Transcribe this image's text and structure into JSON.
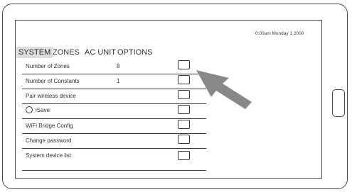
{
  "status_bar": {
    "datetime": "0:00am Monday 1  2000"
  },
  "tabs": [
    {
      "label": "SYSTEM",
      "active": true
    },
    {
      "label": "ZONES",
      "active": false
    },
    {
      "label": "AC UNIT",
      "active": false
    },
    {
      "label": "OPTIONS",
      "active": false
    }
  ],
  "rows": [
    {
      "label": "Number of Zones",
      "value": "8"
    },
    {
      "label": "Number of Constants",
      "value": "1"
    },
    {
      "label": "Pair wireless device",
      "value": ""
    },
    {
      "label": "iSave",
      "value": ""
    },
    {
      "label": "WiFi Bridge Config",
      "value": ""
    },
    {
      "label": "Change password",
      "value": ""
    },
    {
      "label": "System device list",
      "value": ""
    }
  ],
  "colors": {
    "outline": "#4a4a4a",
    "active_tab_bg": "#dcdcdc",
    "arrow": "#888888"
  },
  "icons": {
    "pointer": "arrow-pointer-icon",
    "isave": "radio-circle-icon"
  }
}
